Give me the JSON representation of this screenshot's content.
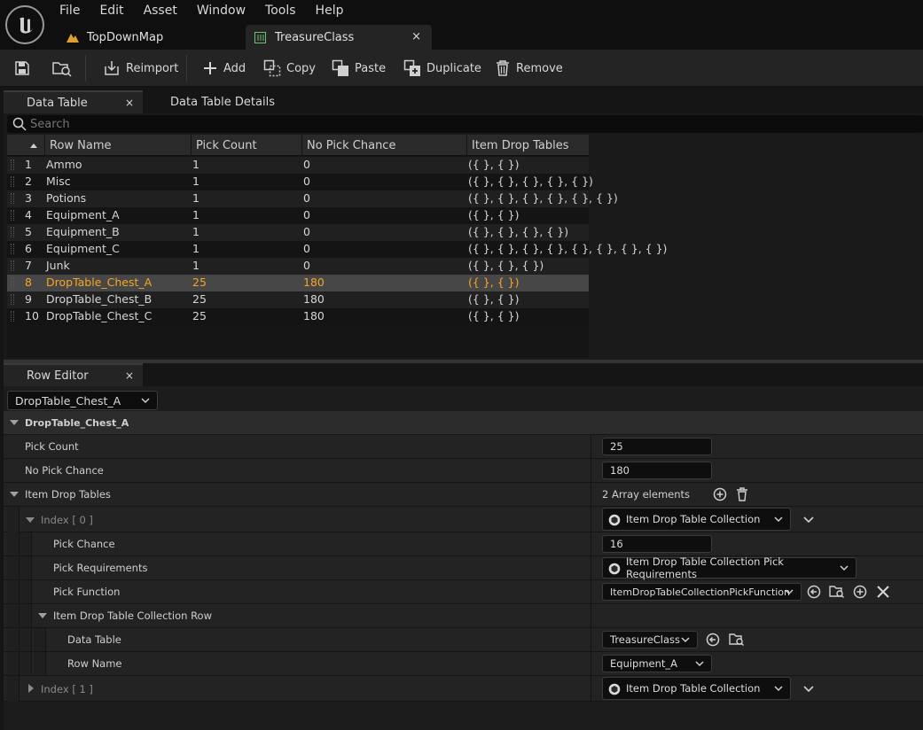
{
  "menu": [
    "File",
    "Edit",
    "Asset",
    "Window",
    "Tools",
    "Help"
  ],
  "tabs": [
    {
      "label": "TopDownMap"
    },
    {
      "label": "TreasureClass",
      "close": "×"
    }
  ],
  "toolbar": {
    "reimport": "Reimport",
    "add": "Add",
    "copy": "Copy",
    "paste": "Paste",
    "duplicate": "Duplicate",
    "remove": "Remove"
  },
  "panels": {
    "data_table_tab": "Data Table",
    "details_tab": "Data Table Details",
    "close": "×",
    "search_placeholder": "Search"
  },
  "table": {
    "columns": [
      "Row Name",
      "Pick Count",
      "No Pick Chance",
      "Item Drop Tables"
    ],
    "rows": [
      {
        "num": "1",
        "name": "Ammo",
        "pick": "1",
        "nopick": "0",
        "drops": "({ }, { })"
      },
      {
        "num": "2",
        "name": "Misc",
        "pick": "1",
        "nopick": "0",
        "drops": "({ }, { }, { }, { }, { })"
      },
      {
        "num": "3",
        "name": "Potions",
        "pick": "1",
        "nopick": "0",
        "drops": "({ }, { }, { }, { }, { }, { })"
      },
      {
        "num": "4",
        "name": "Equipment_A",
        "pick": "1",
        "nopick": "0",
        "drops": "({ }, { })"
      },
      {
        "num": "5",
        "name": "Equipment_B",
        "pick": "1",
        "nopick": "0",
        "drops": "({ }, { }, { }, { })"
      },
      {
        "num": "6",
        "name": "Equipment_C",
        "pick": "1",
        "nopick": "0",
        "drops": "({ }, { }, { }, { }, { }, { }, { }, { })"
      },
      {
        "num": "7",
        "name": "Junk",
        "pick": "1",
        "nopick": "0",
        "drops": "({ }, { }, { })"
      },
      {
        "num": "8",
        "name": "DropTable_Chest_A",
        "pick": "25",
        "nopick": "180",
        "drops": "({ }, { })"
      },
      {
        "num": "9",
        "name": "DropTable_Chest_B",
        "pick": "25",
        "nopick": "180",
        "drops": "({ }, { })"
      },
      {
        "num": "10",
        "name": "DropTable_Chest_C",
        "pick": "25",
        "nopick": "180",
        "drops": "({ }, { })"
      }
    ],
    "selected_row": "8"
  },
  "row_editor": {
    "tab": "Row Editor",
    "selected_row": "DropTable_Chest_A",
    "category": "DropTable_Chest_A",
    "pick_count_label": "Pick Count",
    "pick_count": "25",
    "no_pick_label": "No Pick Chance",
    "no_pick": "180",
    "item_drop_tables_label": "Item Drop Tables",
    "array_elements": "2 Array elements",
    "index0": "Index [ 0 ]",
    "index0_type": "Item Drop Table Collection",
    "pick_chance_label": "Pick Chance",
    "pick_chance": "16",
    "pick_req_label": "Pick Requirements",
    "pick_req": "Item Drop Table Collection Pick Requirements",
    "pick_func_label": "Pick Function",
    "pick_func": "ItemDropTableCollectionPickFunction",
    "collection_row_label": "Item Drop Table Collection Row",
    "data_table_label": "Data Table",
    "data_table": "TreasureClass",
    "row_name_label": "Row Name",
    "row_name": "Equipment_A",
    "index1": "Index [ 1 ]",
    "index1_type": "Item Drop Table Collection"
  },
  "colors": {
    "selected_text": "#f6a623",
    "background": "#151515"
  }
}
